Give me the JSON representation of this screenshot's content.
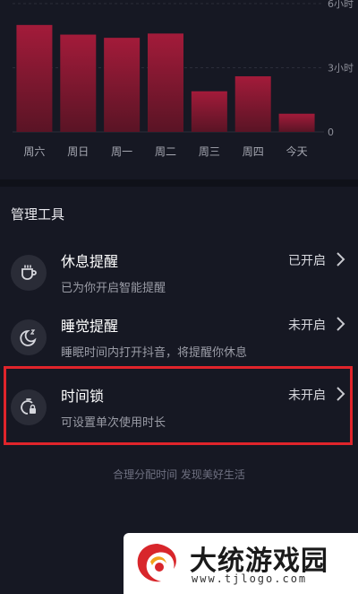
{
  "chart_data": {
    "type": "bar",
    "categories": [
      "周六",
      "周日",
      "周一",
      "周二",
      "周三",
      "周四",
      "今天"
    ],
    "values": [
      5.0,
      4.55,
      4.4,
      4.6,
      1.9,
      2.6,
      0.85
    ],
    "ylim": [
      0,
      6
    ],
    "y_tick_labels": [
      "6小时",
      "3小时",
      "0"
    ],
    "y_tick_values": [
      6,
      3,
      0
    ],
    "bar_color_top": "#a31b3a",
    "bar_color_bottom": "#5a1425",
    "grid": true
  },
  "tools": {
    "section_title": "管理工具",
    "items": [
      {
        "title": "休息提醒",
        "desc": "已为你开启智能提醒",
        "status": "已开启",
        "icon": "cup-icon"
      },
      {
        "title": "睡觉提醒",
        "desc": "睡眠时间内打开抖音，将提醒你休息",
        "status": "未开启",
        "icon": "moon-sleep-icon"
      },
      {
        "title": "时间锁",
        "desc": "可设置单次使用时长",
        "status": "未开启",
        "icon": "timer-lock-icon"
      }
    ]
  },
  "footer": {
    "slogan": "合理分配时间 发现美好生活"
  },
  "watermark": {
    "title": "大统游戏园",
    "url": "www.tjlogo.com"
  },
  "colors": {
    "background": "#161823",
    "highlight": "#e0242b"
  }
}
